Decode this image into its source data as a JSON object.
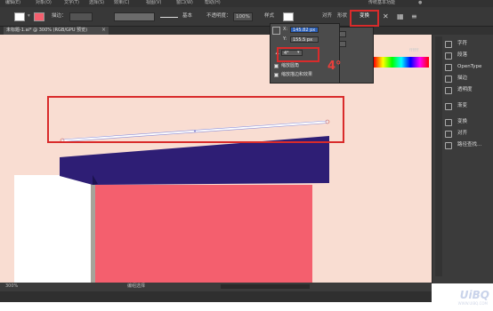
{
  "menubar": {
    "items": [
      "编辑(E)",
      "对象(O)",
      "文字(T)",
      "选择(S)",
      "效果(C)",
      "视图(V)",
      "窗口(W)",
      "帮助(H)"
    ],
    "workspace": "传统基本功能"
  },
  "control": {
    "stroke_label": "描边：",
    "brush_value": "基本",
    "opacity_label": "不透明度：",
    "opacity_value": "100%",
    "style_label": "样式",
    "align_label": "对齐",
    "shape_label": "形状",
    "transform_label": "变换"
  },
  "tab": {
    "title": "未标题-1.ai* @ 300% (RGB/GPU 预览)",
    "close": "×"
  },
  "transform_panel": {
    "x_label": "X:",
    "x_value": "145.82 px",
    "y_label": "Y:",
    "y_value": "155.5 px",
    "w_label": "宽:",
    "w_value": "216.457 px",
    "h_label": "高:",
    "h_value": "25.101 px",
    "angle_value": "4°",
    "shear_value": "0°",
    "opt1": "缩放圆角",
    "opt2": "缩放描边和效果",
    "annotation": "4°",
    "hex_value": "ffffff"
  },
  "right_panel": {
    "items": [
      "字符",
      "段落",
      "OpenType",
      "描边",
      "透明度",
      "渐变",
      "变换",
      "对齐",
      "路径查找..."
    ]
  },
  "status": {
    "zoom": "300%",
    "mode": "编组选择"
  },
  "watermark": {
    "main": "UiBQ",
    "sub": "WWW.UIBQ.COM"
  }
}
